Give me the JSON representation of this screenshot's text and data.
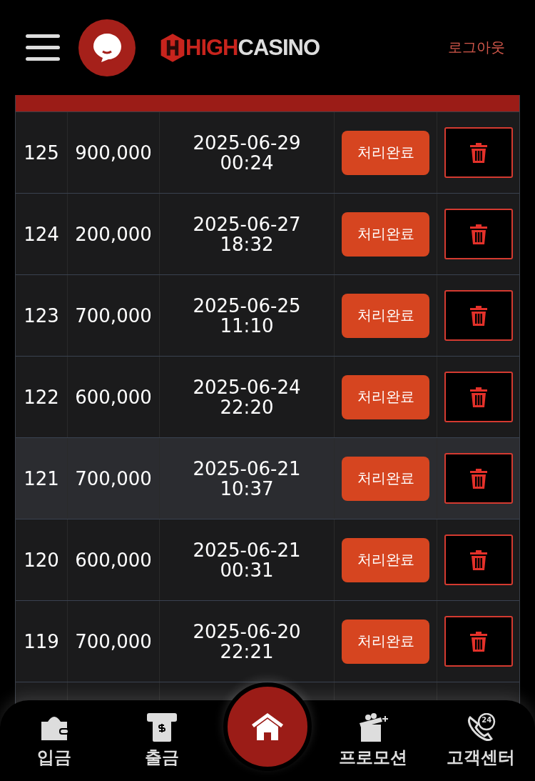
{
  "header": {
    "logo_red": "HIGH",
    "logo_white": "CASINO",
    "logout": "로그아웃"
  },
  "rows": [
    {
      "no": "125",
      "amount": "900,000",
      "date": "2025-06-29",
      "time": "00:24",
      "status": "처리완료",
      "selected": false
    },
    {
      "no": "124",
      "amount": "200,000",
      "date": "2025-06-27",
      "time": "18:32",
      "status": "처리완료",
      "selected": false
    },
    {
      "no": "123",
      "amount": "700,000",
      "date": "2025-06-25",
      "time": "11:10",
      "status": "처리완료",
      "selected": false
    },
    {
      "no": "122",
      "amount": "600,000",
      "date": "2025-06-24",
      "time": "22:20",
      "status": "처리완료",
      "selected": false
    },
    {
      "no": "121",
      "amount": "700,000",
      "date": "2025-06-21",
      "time": "10:37",
      "status": "처리완료",
      "selected": true
    },
    {
      "no": "120",
      "amount": "600,000",
      "date": "2025-06-21",
      "time": "00:31",
      "status": "처리완료",
      "selected": false
    },
    {
      "no": "119",
      "amount": "700,000",
      "date": "2025-06-20",
      "time": "22:21",
      "status": "처리완료",
      "selected": false
    }
  ],
  "bottom_nav": [
    {
      "kind": "wallet",
      "label": "입금"
    },
    {
      "kind": "atm",
      "label": "출금"
    },
    {
      "kind": "home"
    },
    {
      "kind": "gift",
      "label": "프로모션"
    },
    {
      "kind": "support",
      "label": "고객센터",
      "badge": "24"
    }
  ]
}
